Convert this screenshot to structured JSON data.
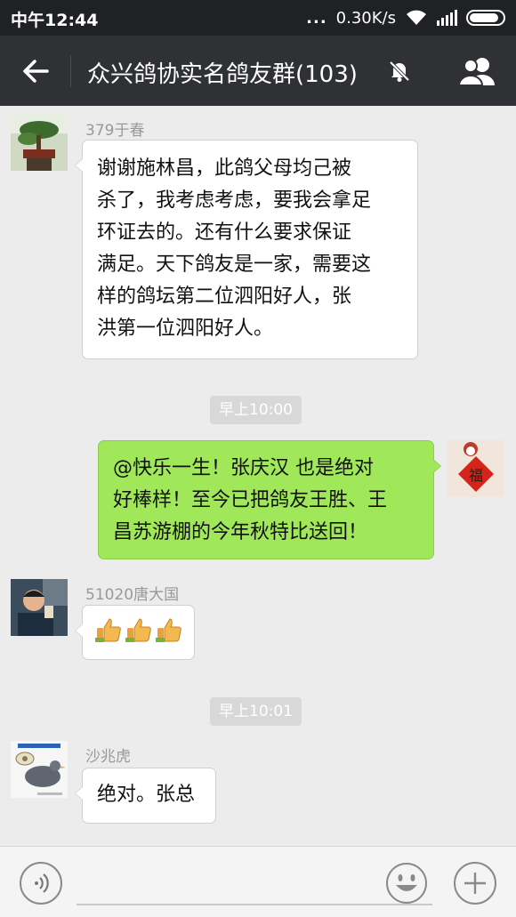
{
  "status_bar": {
    "time": "中午12:44",
    "dots": "...",
    "network_speed": "0.30K/s",
    "icons": [
      "wifi-icon",
      "signal-icon",
      "battery-icon"
    ]
  },
  "header": {
    "title": "众兴鸽协实名鸽友群(103)",
    "icons": [
      "back-arrow-icon",
      "mute-bell-icon",
      "group-members-icon"
    ]
  },
  "messages": [
    {
      "type": "received",
      "sender": "379于春",
      "avatar": "bonsai-avatar",
      "text": "谢谢施林昌，此鸽父母均己被\n杀了，我考虑考虑，要我会拿足\n环证去的。还有什么要求保证\n满足。天下鸽友是一家，需要这\n样的鸽坛第二位泗阳好人，张\n洪第一位泗阳好人。"
    },
    {
      "type": "timestamp",
      "text": "早上10:00"
    },
    {
      "type": "sent",
      "avatar": "fu-character-avatar",
      "text": "@快乐一生！张庆汉 也是绝对\n好棒样！至今已把鸽友王胜、王\n昌苏游棚的今年秋特比送回！"
    },
    {
      "type": "received",
      "sender": "51020唐大国",
      "avatar": "child-photo-avatar",
      "emoji": [
        "thumbs-up-icon",
        "thumbs-up-icon",
        "thumbs-up-icon"
      ]
    },
    {
      "type": "timestamp",
      "text": "早上10:01"
    },
    {
      "type": "received",
      "sender": "沙兆虎",
      "avatar": "pigeon-avatar",
      "text": "绝对。张总"
    }
  ],
  "input_bar": {
    "placeholder": "",
    "icons": [
      "voice-icon",
      "emoji-icon",
      "plus-icon"
    ]
  },
  "colors": {
    "status_bar_bg": "#1f2124",
    "title_bar_bg": "#2f3135",
    "chat_bg": "#ececec",
    "sent_bubble": "#a0e75a",
    "received_bubble": "#ffffff"
  }
}
